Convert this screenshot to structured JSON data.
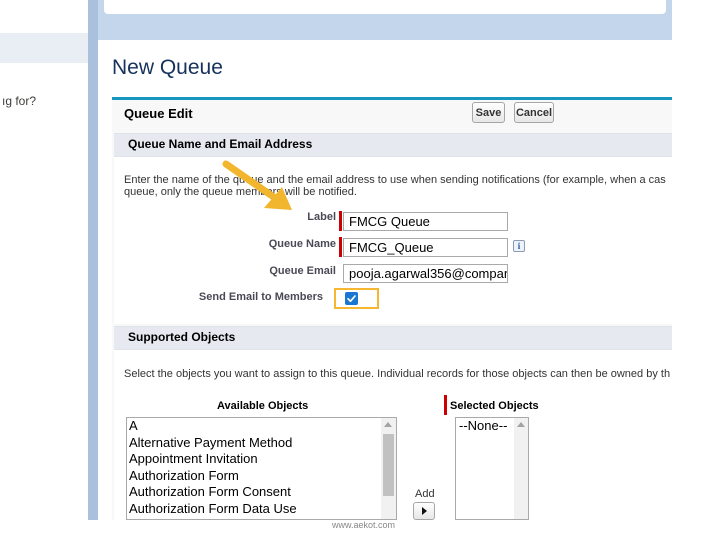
{
  "left_panel": {
    "search_hint": "ıg for?"
  },
  "page": {
    "title": "New Queue"
  },
  "queue_edit": {
    "title": "Queue Edit",
    "save_label": "Save",
    "cancel_label": "Cancel"
  },
  "section_name_email": {
    "title": "Queue Name and Email Address",
    "description_line1": "Enter the name of the queue and the email address to use when sending notifications (for example, when a cas",
    "description_line2": "queue, only the queue members will be notified."
  },
  "fields": {
    "label": {
      "label": "Label",
      "value": "FMCG Queue"
    },
    "queue_name": {
      "label": "Queue Name",
      "value": "FMCG_Queue"
    },
    "queue_email": {
      "label": "Queue Email",
      "value": "pooja.agarwal356@compar"
    },
    "send_email": {
      "label": "Send Email to Members",
      "checked": true
    }
  },
  "section_supported": {
    "title": "Supported Objects",
    "description": "Select the objects you want to assign to this queue. Individual records for those objects can then be owned by th"
  },
  "available_objects": {
    "header": "Available Objects",
    "items": [
      "A",
      "Alternative Payment Method",
      "Appointment Invitation",
      "Authorization Form",
      "Authorization Form Consent",
      "Authorization Form Data Use"
    ]
  },
  "selected_objects": {
    "header": "Selected Objects",
    "items": [
      "--None--"
    ]
  },
  "add_label": "Add",
  "watermark": "www.aekot.com",
  "colors": {
    "accent_bar": "#1797c0",
    "required": "#cc0000",
    "highlight": "#f5b731",
    "checkbox": "#1976d2",
    "arrow": "#f1b52e"
  },
  "icons": [
    "info-icon",
    "scroll-up-icon",
    "add-arrow-icon",
    "annotation-arrow-icon",
    "checkmark-icon"
  ]
}
